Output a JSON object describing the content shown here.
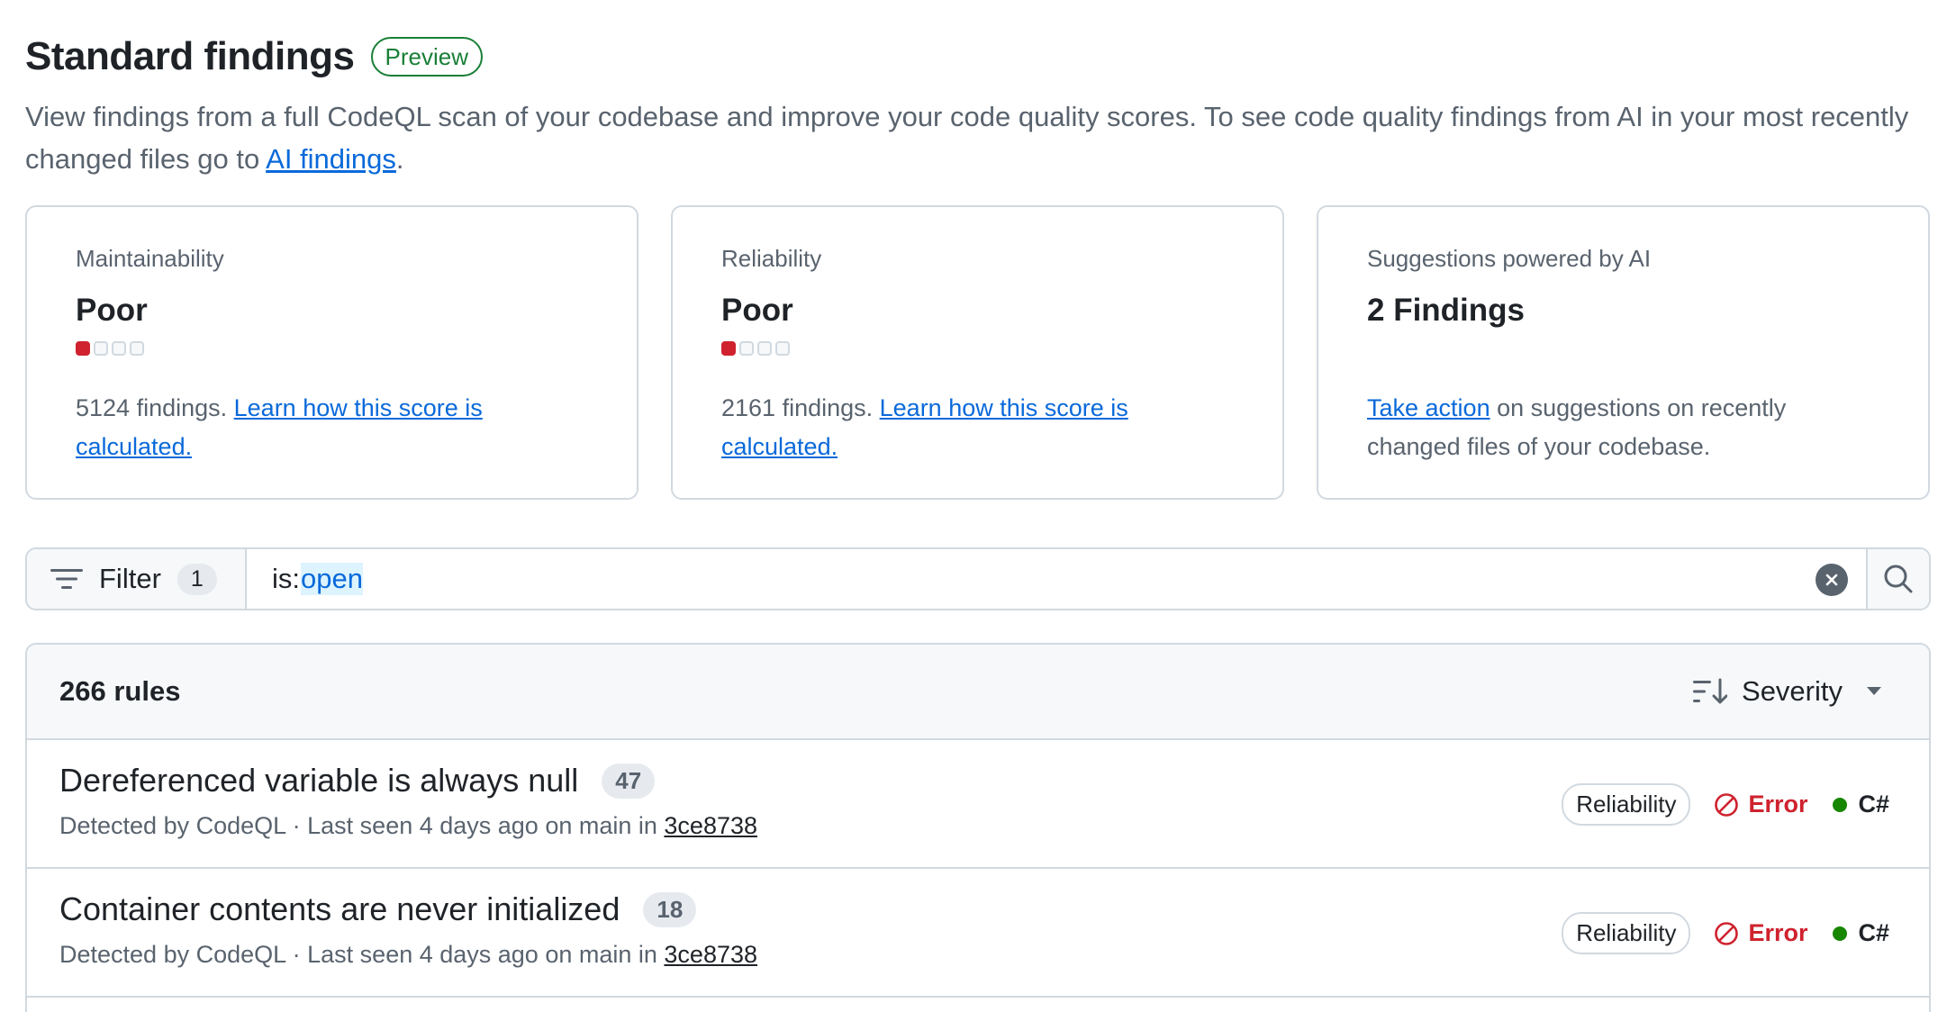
{
  "page": {
    "title": "Standard findings",
    "badge": "Preview",
    "description_pre": "View findings from a full CodeQL scan of your codebase and improve your code quality scores. To see code quality findings from AI in your most recently changed files go to ",
    "description_link": "AI findings",
    "description_post": "."
  },
  "cards": [
    {
      "label": "Maintainability",
      "value": "Poor",
      "score_level": 1,
      "score_max": 4,
      "foot_text": "5124 findings. ",
      "foot_link": "Learn how this score is calculated."
    },
    {
      "label": "Reliability",
      "value": "Poor",
      "score_level": 1,
      "score_max": 4,
      "foot_text": "2161 findings. ",
      "foot_link": "Learn how this score is calculated."
    },
    {
      "label": "Suggestions powered by AI",
      "value": "2 Findings",
      "foot_link": "Take action",
      "foot_text": " on suggestions on recently changed files of your codebase."
    }
  ],
  "filter": {
    "label": "Filter",
    "count": "1",
    "query_key": "is:",
    "query_value": "open"
  },
  "list": {
    "rules_count": "266 rules",
    "sort_label": "Severity",
    "rows": [
      {
        "title": "Dereferenced variable is always null",
        "count": "47",
        "meta": "Detected by CodeQL · Last seen 4 days ago on main in ",
        "commit": "3ce8738",
        "category": "Reliability",
        "severity": "Error",
        "language": "C#"
      },
      {
        "title": "Container contents are never initialized",
        "count": "18",
        "meta": "Detected by CodeQL · Last seen 4 days ago on main in ",
        "commit": "3ce8738",
        "category": "Reliability",
        "severity": "Error",
        "language": "C#"
      }
    ]
  },
  "colors": {
    "accent": "#0969da",
    "success": "#1a7f37",
    "danger": "#cf222e",
    "csharp": "#178600"
  }
}
